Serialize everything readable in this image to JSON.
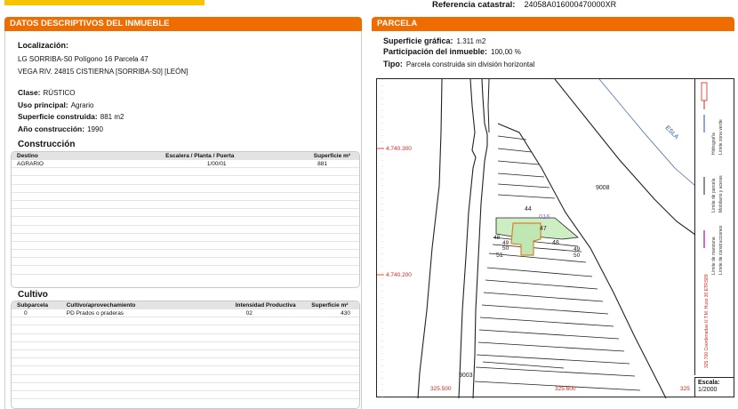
{
  "header": {
    "ref_label": "Referencia catastral:",
    "ref_value": "24058A016000470000XR"
  },
  "left": {
    "band_title_plain": "DATOS DESCRIPTIVOS DEL ",
    "band_title_bold": "INMUEBLE",
    "localizacion_label": "Localización:",
    "address_line1": "LG SORRIBA-S0  Polígono 16 Parcela 47",
    "address_line2": "VEGA RIV. 24815 CISTIERNA [SORRIBA-S0] [LEÓN]",
    "clase_label": "Clase:",
    "clase_value": "RÚSTICO",
    "uso_label": "Uso principal:",
    "uso_value": "Agrario",
    "sup_label": "Superficie construida:",
    "sup_value": "881 m2",
    "anio_label": "Año construcción:",
    "anio_value": "1990"
  },
  "construccion": {
    "title": "Construcción",
    "headers": [
      "Destino",
      "Escalera / Planta / Puerta",
      "Superficie m²"
    ],
    "rows": [
      [
        "AGRARIO",
        "1/00/01",
        "881"
      ]
    ],
    "empty_rows": 13
  },
  "cultivo": {
    "title": "Cultivo",
    "headers": [
      "Subparcela",
      "Cultivo/aprovechamiento",
      "Intensidad Productiva",
      "Superficie m²"
    ],
    "rows": [
      [
        "0",
        "PD Prados o praderas",
        "02",
        "430"
      ]
    ],
    "empty_rows": 10
  },
  "right": {
    "band_title": "PARCELA",
    "sup_grafica_label": "Superficie gráfica:",
    "sup_grafica_value": "1.311 m2",
    "particip_label": "Participación del inmueble:",
    "particip_value": "100,00 %",
    "tipo_label": "Tipo:",
    "tipo_value": "Parcela construida sin división horizontal"
  },
  "map": {
    "y_labels": [
      "4.740.300",
      "4.740.200"
    ],
    "x_labels": [
      "325.500",
      "325.600",
      "325"
    ],
    "parcel_labels": [
      "9008",
      "44",
      "016",
      "47",
      "48",
      "49",
      "50",
      "51",
      "48",
      "49",
      "50",
      "9003"
    ],
    "river_label": "ESLA",
    "legend_items": [
      "Hidrografía",
      "Límite zona verde",
      "Límite de parcela",
      "Mobiliario y aceras",
      "Límite de manzana",
      "Límite de construcciones"
    ],
    "coords_text": "325.700 Coordenadas U.T.M. Huso 30 ETRS89",
    "scale_label": "Escala:",
    "scale_value": "1/2000",
    "colors": {
      "frame": "#222222",
      "text_red": "#d8241c",
      "parcel_fill": "#cdeec3",
      "building_outline": "#d9822b",
      "label_purple": "#9a6ccf",
      "river_blue": "#1c4fa8"
    }
  },
  "colors": {
    "accent": "#ef6c00",
    "yellow": "#f6c500"
  }
}
